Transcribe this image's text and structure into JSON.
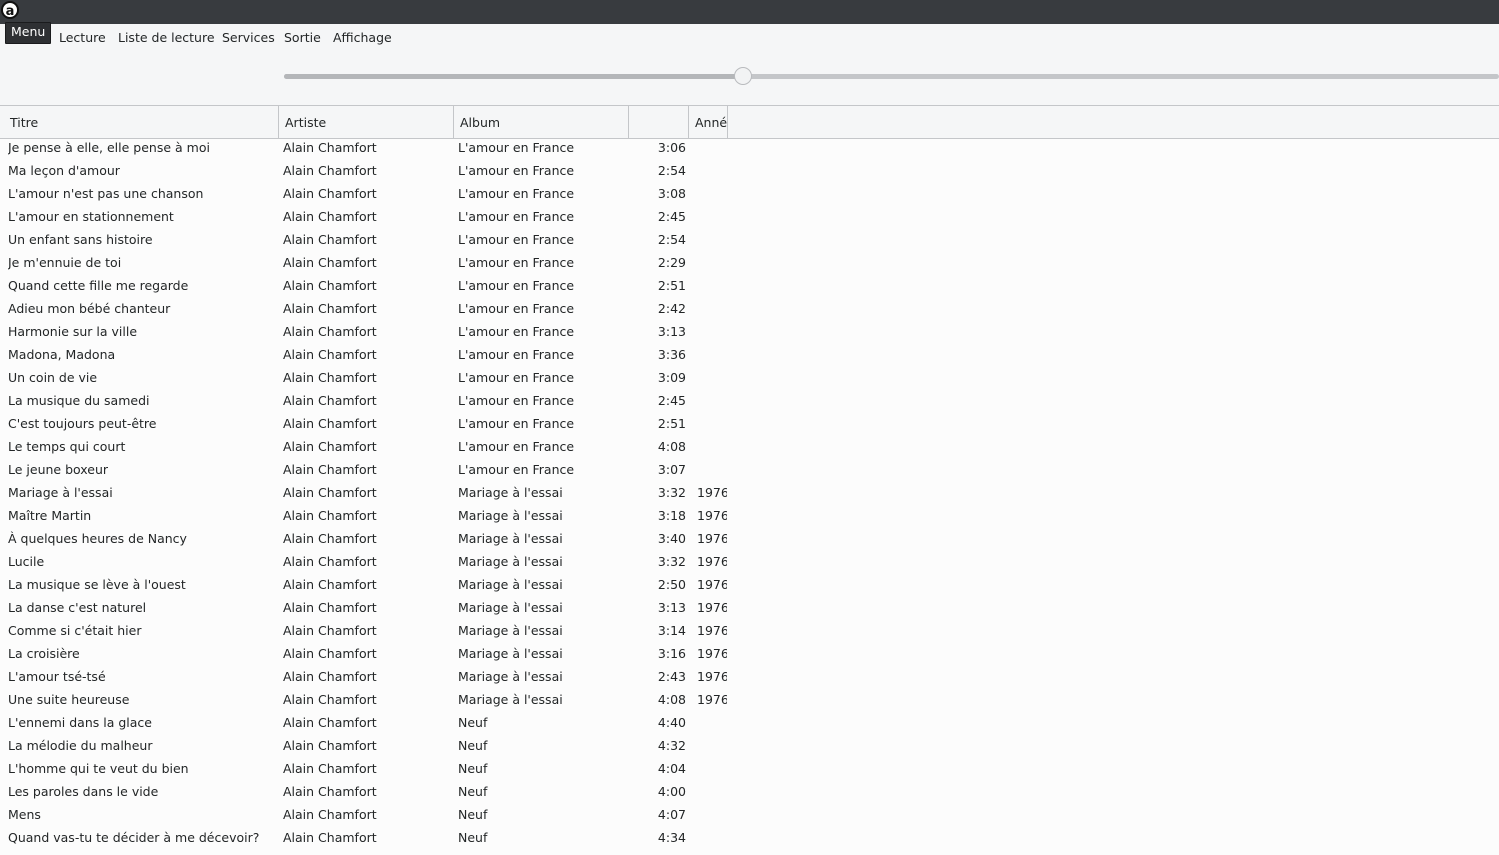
{
  "app": {
    "icon_letter": "a"
  },
  "menu": {
    "items": [
      {
        "label": "Menu",
        "active": true
      },
      {
        "label": "Lecture"
      },
      {
        "label": "Liste de lecture"
      },
      {
        "label": "Services"
      },
      {
        "label": "Sortie"
      },
      {
        "label": "Affichage"
      }
    ]
  },
  "seek": {
    "position_fraction": 0.378
  },
  "table": {
    "columns": [
      "Titre",
      "Artiste",
      "Album",
      "",
      "Année"
    ],
    "rows": [
      [
        "Je pense à elle, elle pense à moi",
        "Alain Chamfort",
        "L'amour en France",
        "3:06",
        ""
      ],
      [
        "Ma leçon d'amour",
        "Alain Chamfort",
        "L'amour en France",
        "2:54",
        ""
      ],
      [
        "L'amour n'est pas une chanson",
        "Alain Chamfort",
        "L'amour en France",
        "3:08",
        ""
      ],
      [
        "L'amour en stationnement",
        "Alain Chamfort",
        "L'amour en France",
        "2:45",
        ""
      ],
      [
        "Un enfant sans histoire",
        "Alain Chamfort",
        "L'amour en France",
        "2:54",
        ""
      ],
      [
        "Je m'ennuie de toi",
        "Alain Chamfort",
        "L'amour en France",
        "2:29",
        ""
      ],
      [
        "Quand cette fille me regarde",
        "Alain Chamfort",
        "L'amour en France",
        "2:51",
        ""
      ],
      [
        "Adieu mon bébé chanteur",
        "Alain Chamfort",
        "L'amour en France",
        "2:42",
        ""
      ],
      [
        "Harmonie sur la ville",
        "Alain Chamfort",
        "L'amour en France",
        "3:13",
        ""
      ],
      [
        "Madona, Madona",
        "Alain Chamfort",
        "L'amour en France",
        "3:36",
        ""
      ],
      [
        "Un coin de vie",
        "Alain Chamfort",
        "L'amour en France",
        "3:09",
        ""
      ],
      [
        "La musique du samedi",
        "Alain Chamfort",
        "L'amour en France",
        "2:45",
        ""
      ],
      [
        "C'est toujours peut-être",
        "Alain Chamfort",
        "L'amour en France",
        "2:51",
        ""
      ],
      [
        "Le temps qui court",
        "Alain Chamfort",
        "L'amour en France",
        "4:08",
        ""
      ],
      [
        "Le jeune boxeur",
        "Alain Chamfort",
        "L'amour en France",
        "3:07",
        ""
      ],
      [
        "Mariage à l'essai",
        "Alain Chamfort",
        "Mariage à l'essai",
        "3:32",
        "1976"
      ],
      [
        "Maître Martin",
        "Alain Chamfort",
        "Mariage à l'essai",
        "3:18",
        "1976"
      ],
      [
        "À quelques heures de Nancy",
        "Alain Chamfort",
        "Mariage à l'essai",
        "3:40",
        "1976"
      ],
      [
        "Lucile",
        "Alain Chamfort",
        "Mariage à l'essai",
        "3:32",
        "1976"
      ],
      [
        "La musique se lève à l'ouest",
        "Alain Chamfort",
        "Mariage à l'essai",
        "2:50",
        "1976"
      ],
      [
        "La danse c'est naturel",
        "Alain Chamfort",
        "Mariage à l'essai",
        "3:13",
        "1976"
      ],
      [
        "Comme si c'était hier",
        "Alain Chamfort",
        "Mariage à l'essai",
        "3:14",
        "1976"
      ],
      [
        "La croisière",
        "Alain Chamfort",
        "Mariage à l'essai",
        "3:16",
        "1976"
      ],
      [
        "L'amour tsé-tsé",
        "Alain Chamfort",
        "Mariage à l'essai",
        "2:43",
        "1976"
      ],
      [
        "Une suite heureuse",
        "Alain Chamfort",
        "Mariage à l'essai",
        "4:08",
        "1976"
      ],
      [
        "L'ennemi dans la glace",
        "Alain Chamfort",
        "Neuf",
        "4:40",
        ""
      ],
      [
        "La mélodie du malheur",
        "Alain Chamfort",
        "Neuf",
        "4:32",
        ""
      ],
      [
        "L'homme qui te veut du bien",
        "Alain Chamfort",
        "Neuf",
        "4:04",
        ""
      ],
      [
        "Les paroles dans le vide",
        "Alain Chamfort",
        "Neuf",
        "4:00",
        ""
      ],
      [
        "Mens",
        "Alain Chamfort",
        "Neuf",
        "4:07",
        ""
      ],
      [
        "Quand vas-tu te décider à me décevoir?",
        "Alain Chamfort",
        "Neuf",
        "4:34",
        ""
      ]
    ]
  }
}
